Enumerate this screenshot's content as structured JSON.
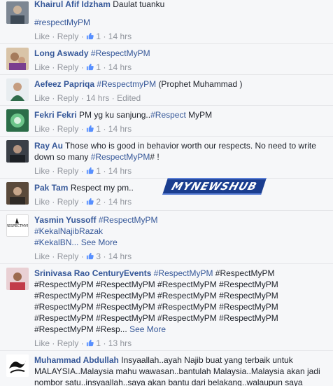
{
  "colors": {
    "link": "#365899",
    "meta": "#90949c",
    "text": "#1d2129",
    "watermark": "#1a3d8f"
  },
  "actions": {
    "like": "Like",
    "reply": "Reply",
    "dot": "·"
  },
  "watermark": "MYNEWSHUB",
  "comments": [
    {
      "author": "Khairul Afif Idzham",
      "text": "Daulat tuanku",
      "line2": "#respectMyPM",
      "likes": "1",
      "time": "14 hrs"
    },
    {
      "author": "Long Aswady",
      "tag": "#RespectMyPM",
      "likes": "1",
      "time": "14 hrs"
    },
    {
      "author": "Aefeez Papriqa",
      "tag": "#RespectmyPM",
      "text": "(Prophet Muhammad )",
      "time": "14 hrs",
      "edited": "Edited"
    },
    {
      "author": "Fekri Fekri",
      "text": "PM yg ku sanjung..",
      "tag": "#Respect",
      "text2": "MyPM",
      "likes": "1",
      "time": "14 hrs"
    },
    {
      "author": "Ray Au",
      "text": "Those who is good in behavior worth our respects. No need to write",
      "text_b": "down so many",
      "tag": "#RespectMyPM",
      "text2": "# !",
      "likes": "1",
      "time": "14 hrs"
    },
    {
      "author": "Pak Tam",
      "text": "Respect my pm..",
      "likes": "2",
      "time": "14 hrs"
    },
    {
      "author": "Yasmin Yussoff",
      "tag": "#RespectMyPM",
      "tag2": "#KekalNajibRazak",
      "tag3": "#KekalBN...",
      "more": "See More",
      "likes": "3",
      "time": "14 hrs"
    },
    {
      "author": "Srinivasa Rao CenturyEvents",
      "tag": "#RespectMyPM",
      "text": "#RespectMyPM",
      "rows": [
        "#RespectMyPM #RespectMyPM #RespectMyPM #RespectMyPM",
        "#RespectMyPM #RespectMyPM #RespectMyPM #RespectMyPM",
        "#RespectMyPM #RespectMyPM #RespectMyPM #RespectMyPM",
        "#RespectMyPM #RespectMyPM #RespectMyPM #RespectMyPM"
      ],
      "last": "#RespectMyPM #Resp...",
      "more": "See More",
      "likes": "1",
      "time": "13 hrs"
    },
    {
      "author": "Muhammad Abdullah",
      "text": "Insyaallah..ayah Najib buat yang terbaik untuk",
      "text_b": "MALAYSIA..Malaysia mahu wawasan..bantulah Malaysia..Malaysia akan jadi",
      "text_c": "nombor satu..insyaallah..saya akan bantu dari belakang..walaupun saya"
    }
  ]
}
